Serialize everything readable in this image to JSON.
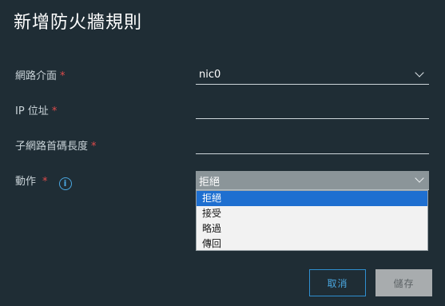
{
  "dialog": {
    "title": "新增防火牆規則"
  },
  "form": {
    "interface": {
      "label": "網路介面",
      "required_mark": "*",
      "value": "nic0"
    },
    "ip": {
      "label": "IP 位址",
      "required_mark": "*",
      "value": ""
    },
    "subnet": {
      "label": "子網路首碼長度",
      "required_mark": "*",
      "value": ""
    },
    "action": {
      "label": "動作",
      "required_mark": "*",
      "info_icon": "i",
      "value": "拒絕",
      "options": [
        "拒絕",
        "接受",
        "略過",
        "傳回"
      ],
      "selected_index": 0
    }
  },
  "buttons": {
    "cancel": "取消",
    "save": "儲存"
  },
  "colors": {
    "background": "#1f2d35",
    "accent": "#4aa7e0",
    "required": "#e04b4b",
    "highlight": "#1e6fd0"
  }
}
